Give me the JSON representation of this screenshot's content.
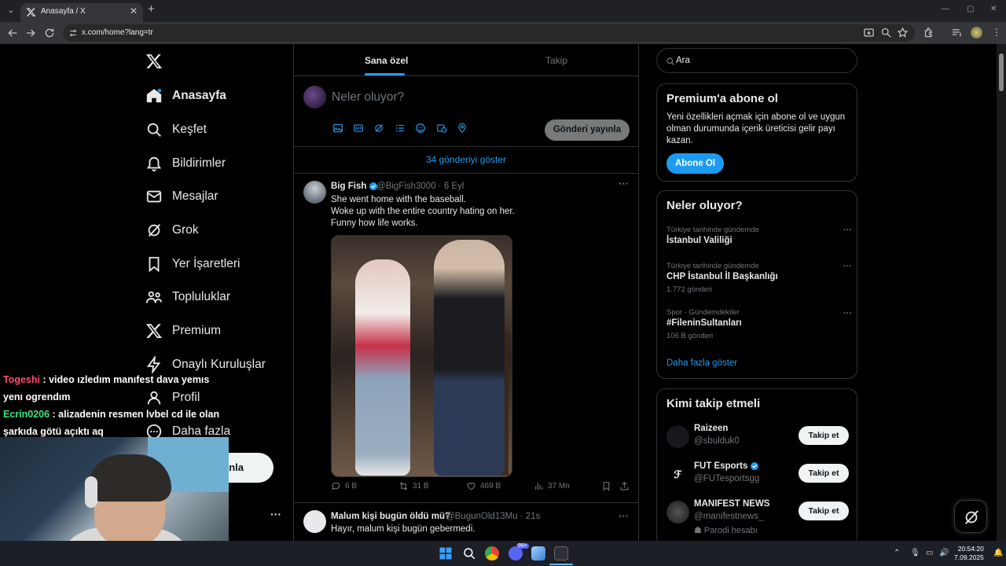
{
  "browser": {
    "tab_title": "Anasayfa / X",
    "url": "x.com/home?lang=tr"
  },
  "sidebar": {
    "items": [
      {
        "label": "Anasayfa",
        "icon": "home-icon"
      },
      {
        "label": "Keşfet",
        "icon": "search-icon"
      },
      {
        "label": "Bildirimler",
        "icon": "bell-icon"
      },
      {
        "label": "Mesajlar",
        "icon": "mail-icon"
      },
      {
        "label": "Grok",
        "icon": "grok-icon"
      },
      {
        "label": "Yer İşaretleri",
        "icon": "bookmark-icon"
      },
      {
        "label": "Topluluklar",
        "icon": "people-icon"
      },
      {
        "label": "Premium",
        "icon": "x-icon"
      },
      {
        "label": "Onaylı Kuruluşlar",
        "icon": "lightning-icon"
      },
      {
        "label": "Profil",
        "icon": "person-icon"
      },
      {
        "label": "Daha fazla",
        "icon": "more-circle-icon"
      }
    ],
    "post_button_partial": "nla"
  },
  "chat_overlay": [
    {
      "user": "Togeshi",
      "message": " : video ızledım manıfest dava yemıs yenı ogrendım"
    },
    {
      "user": "Ecrin0206",
      "message": " : alizadenin resmen lvbel cd ile olan şarkıda götü açıktı aq"
    }
  ],
  "main": {
    "tabs": [
      {
        "label": "Sana özel",
        "selected": true
      },
      {
        "label": "Takip",
        "selected": false
      }
    ],
    "composer": {
      "placeholder": "Neler oluyor?",
      "post_label": "Gönderi yayınla"
    },
    "show_new": "34 gönderiyi göster",
    "tweets": [
      {
        "name": "Big Fish",
        "verified": true,
        "handle": "@BigFish3000 · 6 Eyl",
        "lines": [
          "She went home with the baseball.",
          "Woke up with the entire country hating on her.",
          "Funny how life works."
        ],
        "replies": "6 B",
        "reposts": "31 B",
        "likes": "469 B",
        "views": "37 Mn"
      },
      {
        "name": "Malum kişi bugün öldü mü?",
        "handle": "@BugunOld13Mu · 21s",
        "text": "Hayır, malum kişi bugün gebermedi."
      }
    ]
  },
  "right": {
    "search_placeholder": "Ara",
    "premium": {
      "title": "Premium'a abone ol",
      "text": "Yeni özellikleri açmak için abone ol ve uygun olman durumunda içerik üreticisi gelir payı kazan.",
      "button": "Abone Ol"
    },
    "trends": {
      "title": "Neler oluyor?",
      "items": [
        {
          "category": "Türkiye tarihinde gündemde",
          "name": "İstanbul Valiliği",
          "count": ""
        },
        {
          "category": "Türkiye tarihinde gündemde",
          "name": "CHP İstanbul İl Başkanlığı",
          "count": "1.772 gönderi"
        },
        {
          "category": "Spor · Gündemdekiler",
          "name": "#FileninSultanları",
          "count": "106 B gönderi"
        }
      ],
      "show_more": "Daha fazla göster"
    },
    "who_to_follow": {
      "title": "Kimi takip etmeli",
      "items": [
        {
          "name": "Raizeen",
          "handle": "@sbulduk0",
          "extra": "",
          "verified": false
        },
        {
          "name": "FUT Esports",
          "handle": "@FUTesportsgg",
          "extra": "",
          "verified": true
        },
        {
          "name": "MANIFEST NEWS",
          "handle": "@manifestnews_",
          "extra": "Parodi hesabı",
          "verified": false
        }
      ],
      "follow_label": "Takip et"
    }
  },
  "taskbar": {
    "time": "20:54:20",
    "date": "7.09.2025",
    "badge": "99+"
  },
  "colors": {
    "accent": "#1d9bf0",
    "background": "#000000",
    "border": "#2f3336",
    "muted": "#71767b"
  }
}
